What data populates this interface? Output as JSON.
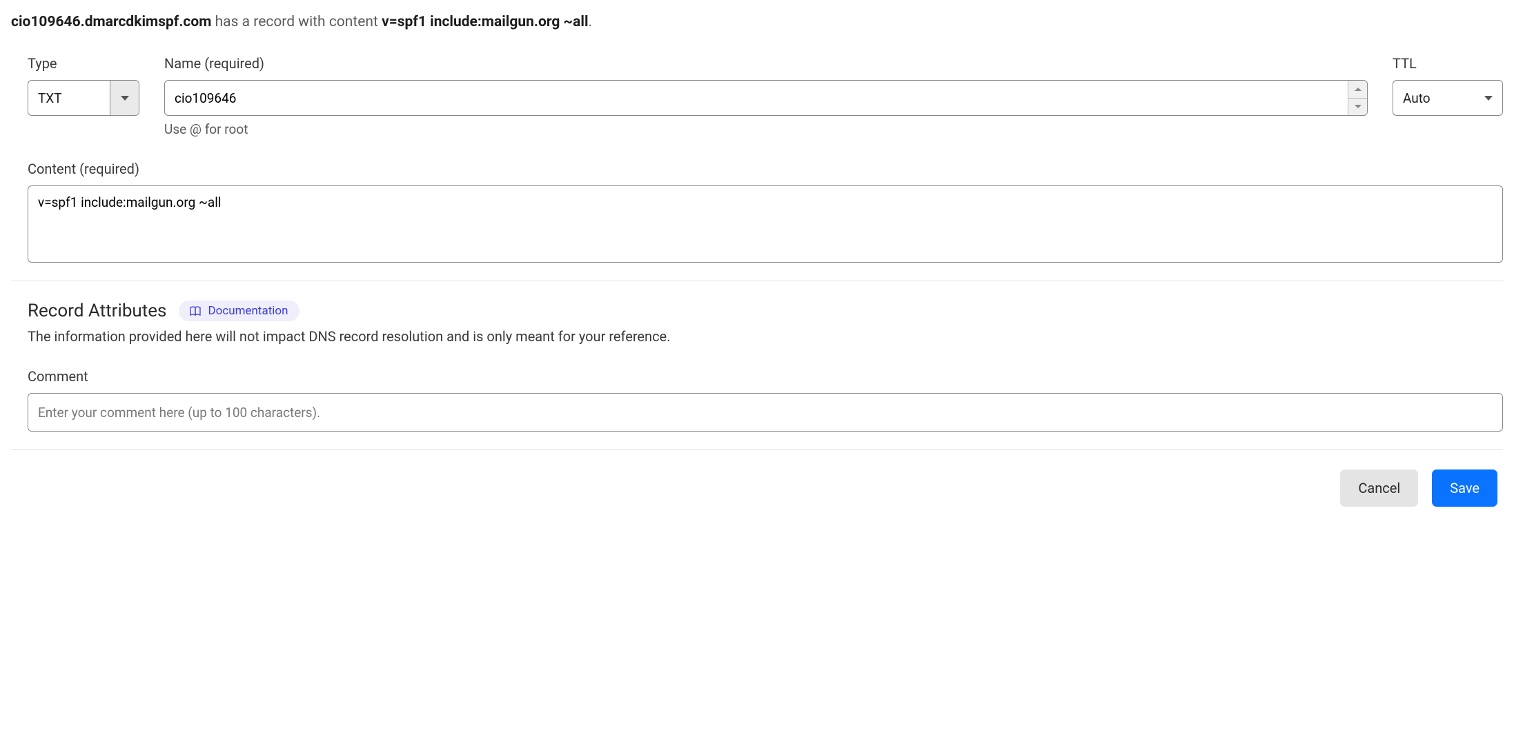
{
  "header": {
    "domain": "cio109646.dmarcdkimspf.com",
    "mid_text": " has a record with content ",
    "record_content": "v=spf1 include:mailgun.org ~all",
    "suffix": "."
  },
  "fields": {
    "type": {
      "label": "Type",
      "value": "TXT"
    },
    "name": {
      "label": "Name (required)",
      "value": "cio109646",
      "hint": "Use @ for root"
    },
    "ttl": {
      "label": "TTL",
      "value": "Auto"
    },
    "content": {
      "label": "Content (required)",
      "value": "v=spf1 include:mailgun.org ~all"
    }
  },
  "attributes": {
    "title": "Record Attributes",
    "doc_link": "Documentation",
    "description": "The information provided here will not impact DNS record resolution and is only meant for your reference.",
    "comment": {
      "label": "Comment",
      "placeholder": "Enter your comment here (up to 100 characters).",
      "value": ""
    }
  },
  "buttons": {
    "cancel": "Cancel",
    "save": "Save"
  }
}
